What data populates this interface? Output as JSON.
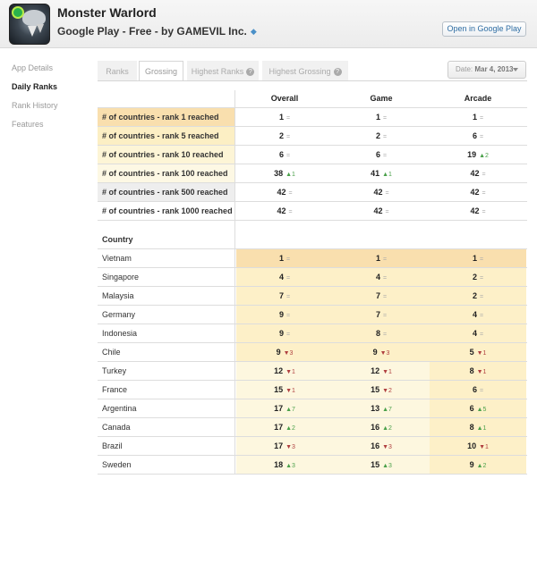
{
  "header": {
    "title": "Monster Warlord",
    "subtitle": "Google Play - Free - by GAMEVIL Inc.",
    "open_button": "Open in Google Play"
  },
  "sidebar": {
    "items": [
      {
        "label": "App Details",
        "active": false
      },
      {
        "label": "Daily Ranks",
        "active": true
      },
      {
        "label": "Rank History",
        "active": false
      },
      {
        "label": "Features",
        "active": false
      }
    ]
  },
  "tabs": [
    {
      "label": "Ranks",
      "active": false
    },
    {
      "label": "Grossing",
      "active": true
    },
    {
      "label": "Highest Ranks",
      "active": false,
      "help": true
    },
    {
      "label": "Highest Grossing",
      "active": false,
      "help": true
    }
  ],
  "date_picker": {
    "prefix": "Date:",
    "value": "Mar 4, 2013"
  },
  "columns": [
    "Overall",
    "Game",
    "Arcade"
  ],
  "summary_rows": [
    {
      "label": "# of countries - rank 1 reached",
      "cells": [
        {
          "v": "1",
          "d": "eq",
          "c": "="
        },
        {
          "v": "1",
          "d": "eq",
          "c": "="
        },
        {
          "v": "1",
          "d": "eq",
          "c": "="
        }
      ],
      "bg": "#f9dfae"
    },
    {
      "label": "# of countries - rank 5 reached",
      "cells": [
        {
          "v": "2",
          "d": "eq",
          "c": "="
        },
        {
          "v": "2",
          "d": "eq",
          "c": "="
        },
        {
          "v": "6",
          "d": "eq",
          "c": "="
        }
      ],
      "bg": "#fcefc4"
    },
    {
      "label": "# of countries - rank 10 reached",
      "cells": [
        {
          "v": "6",
          "d": "eq",
          "c": "="
        },
        {
          "v": "6",
          "d": "eq",
          "c": "="
        },
        {
          "v": "19",
          "d": "up",
          "c": "▲2"
        }
      ],
      "bg": "#fdf5d6"
    },
    {
      "label": "# of countries - rank 100 reached",
      "cells": [
        {
          "v": "38",
          "d": "up",
          "c": "▲1"
        },
        {
          "v": "41",
          "d": "up",
          "c": "▲1"
        },
        {
          "v": "42",
          "d": "eq",
          "c": "="
        }
      ],
      "bg": "#fdf8e4"
    },
    {
      "label": "# of countries - rank 500 reached",
      "cells": [
        {
          "v": "42",
          "d": "eq",
          "c": "="
        },
        {
          "v": "42",
          "d": "eq",
          "c": "="
        },
        {
          "v": "42",
          "d": "eq",
          "c": "="
        }
      ],
      "bg": "#eeeeee"
    },
    {
      "label": "# of countries - rank 1000 reached",
      "cells": [
        {
          "v": "42",
          "d": "eq",
          "c": "="
        },
        {
          "v": "42",
          "d": "eq",
          "c": "="
        },
        {
          "v": "42",
          "d": "eq",
          "c": "="
        }
      ],
      "bg": "#ffffff"
    }
  ],
  "country_header": "Country",
  "country_rows": [
    {
      "label": "Vietnam",
      "cells": [
        {
          "v": "1",
          "d": "eq",
          "c": "="
        },
        {
          "v": "1",
          "d": "eq",
          "c": "="
        },
        {
          "v": "1",
          "d": "eq",
          "c": "="
        }
      ]
    },
    {
      "label": "Singapore",
      "cells": [
        {
          "v": "4",
          "d": "eq",
          "c": "="
        },
        {
          "v": "4",
          "d": "eq",
          "c": "="
        },
        {
          "v": "2",
          "d": "eq",
          "c": "="
        }
      ]
    },
    {
      "label": "Malaysia",
      "cells": [
        {
          "v": "7",
          "d": "eq",
          "c": "="
        },
        {
          "v": "7",
          "d": "eq",
          "c": "="
        },
        {
          "v": "2",
          "d": "eq",
          "c": "="
        }
      ]
    },
    {
      "label": "Germany",
      "cells": [
        {
          "v": "9",
          "d": "eq",
          "c": "="
        },
        {
          "v": "7",
          "d": "eq",
          "c": "="
        },
        {
          "v": "4",
          "d": "eq",
          "c": "="
        }
      ]
    },
    {
      "label": "Indonesia",
      "cells": [
        {
          "v": "9",
          "d": "eq",
          "c": "="
        },
        {
          "v": "8",
          "d": "eq",
          "c": "="
        },
        {
          "v": "4",
          "d": "eq",
          "c": "="
        }
      ]
    },
    {
      "label": "Chile",
      "cells": [
        {
          "v": "9",
          "d": "down",
          "c": "▼3"
        },
        {
          "v": "9",
          "d": "down",
          "c": "▼3"
        },
        {
          "v": "5",
          "d": "down",
          "c": "▼1"
        }
      ]
    },
    {
      "label": "Turkey",
      "cells": [
        {
          "v": "12",
          "d": "down",
          "c": "▼1"
        },
        {
          "v": "12",
          "d": "down",
          "c": "▼1"
        },
        {
          "v": "8",
          "d": "down",
          "c": "▼1"
        }
      ]
    },
    {
      "label": "France",
      "cells": [
        {
          "v": "15",
          "d": "down",
          "c": "▼1"
        },
        {
          "v": "15",
          "d": "down",
          "c": "▼2"
        },
        {
          "v": "6",
          "d": "eq",
          "c": "="
        }
      ]
    },
    {
      "label": "Argentina",
      "cells": [
        {
          "v": "17",
          "d": "up",
          "c": "▲7"
        },
        {
          "v": "13",
          "d": "up",
          "c": "▲7"
        },
        {
          "v": "6",
          "d": "up",
          "c": "▲5"
        }
      ]
    },
    {
      "label": "Canada",
      "cells": [
        {
          "v": "17",
          "d": "up",
          "c": "▲2"
        },
        {
          "v": "16",
          "d": "up",
          "c": "▲2"
        },
        {
          "v": "8",
          "d": "up",
          "c": "▲1"
        }
      ]
    },
    {
      "label": "Brazil",
      "cells": [
        {
          "v": "17",
          "d": "down",
          "c": "▼3"
        },
        {
          "v": "16",
          "d": "down",
          "c": "▼3"
        },
        {
          "v": "10",
          "d": "down",
          "c": "▼1"
        }
      ]
    },
    {
      "label": "Sweden",
      "cells": [
        {
          "v": "18",
          "d": "up",
          "c": "▲3"
        },
        {
          "v": "15",
          "d": "up",
          "c": "▲3"
        },
        {
          "v": "9",
          "d": "up",
          "c": "▲2"
        }
      ]
    }
  ],
  "colors": {
    "up": "#4aa04a",
    "down": "#b04040",
    "rank_top": "#f9dfae",
    "rank_mid": "#fdf0c8",
    "rank_low": "#fdf7df"
  }
}
